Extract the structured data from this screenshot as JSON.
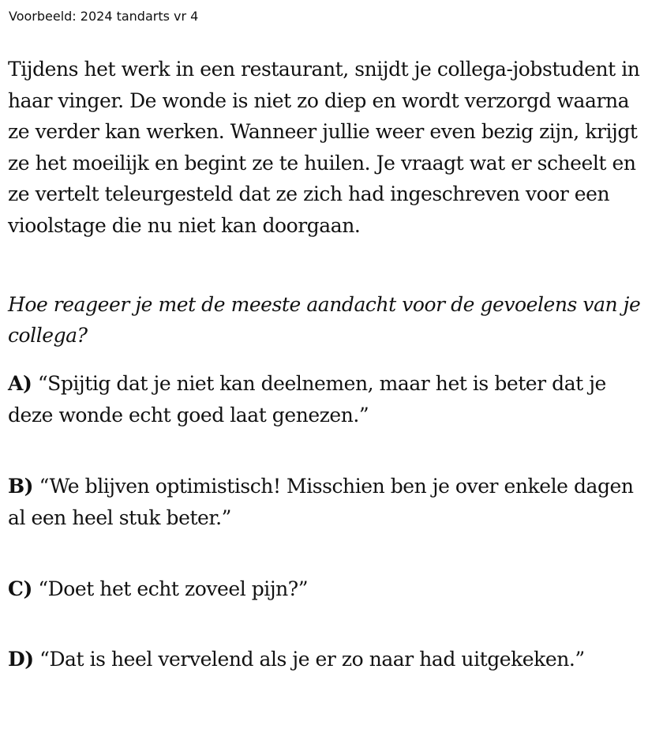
{
  "header": {
    "text": "Voorbeeld: 2024 tandarts vr 4"
  },
  "scenario": {
    "text": "Tijdens het werk in een restaurant, snijdt je collega-jobstudent in haar vinger. De wonde is niet zo diep en wordt verzorgd waarna ze verder kan werken. Wanneer jullie weer even bezig zijn, krijgt ze het moeilijk en begint ze te huilen. Je vraagt wat er scheelt en ze vertelt teleurgesteld dat ze zich had ingeschreven voor een vioolstage die nu niet kan doorgaan."
  },
  "question": {
    "text": "Hoe reageer je met de meeste aandacht voor de gevoelens van je collega?"
  },
  "options": [
    {
      "letter": "A)",
      "text": "“Spijtig dat je niet kan deelnemen, maar het is beter dat je deze wonde echt goed laat genezen.”"
    },
    {
      "letter": "B)",
      "text": "“We blijven optimistisch! Misschien ben je over enkele dagen al een heel stuk beter.”"
    },
    {
      "letter": "C)",
      "text": "“Doet het echt zoveel pijn?”"
    },
    {
      "letter": "D)",
      "text": "“Dat is heel vervelend als je er zo naar had uitgekeken.”"
    }
  ]
}
